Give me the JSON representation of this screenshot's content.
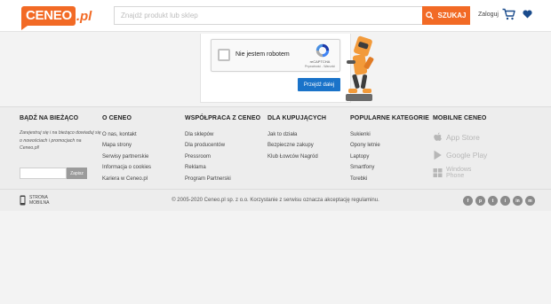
{
  "header": {
    "logo_text": "CENEO",
    "logo_suffix": ".pl",
    "search_placeholder": "Znajdź produkt lub sklep",
    "search_button": "SZUKAJ",
    "login": "Zaloguj",
    "brand_color": "#f26a25"
  },
  "captcha": {
    "label": "Nie jestem robotem",
    "brand": "reCAPTCHA",
    "links": "Prywatność - Warunki",
    "proceed_button": "Przejdź dalej"
  },
  "footer": {
    "newsletter": {
      "heading": "BĄDŹ NA BIEŻĄCO",
      "description": "Zarejestruj się i na bieżąco dowiaduj się o nowościach i promocjach na Ceneo.pl!",
      "button": "Zapisz"
    },
    "columns": [
      {
        "heading": "O CENEO",
        "links": [
          "O nas, kontakt",
          "Mapa strony",
          "Serwisy partnerskie",
          "Informacja o cookies",
          "Kariera w Ceneo.pl"
        ]
      },
      {
        "heading": "WSPÓŁPRACA Z CENEO",
        "links": [
          "Dla sklepów",
          "Dla producentów",
          "Pressroom",
          "Reklama",
          "Program Partnerski"
        ]
      },
      {
        "heading": "DLA KUPUJĄCYCH",
        "links": [
          "Jak to działa",
          "Bezpieczne zakupy",
          "Klub Łowców Nagród"
        ]
      },
      {
        "heading": "POPULARNE KATEGORIE",
        "links": [
          "Sukienki",
          "Opony letnie",
          "Laptopy",
          "Smartfony",
          "Torebki"
        ]
      }
    ],
    "mobile": {
      "heading": "MOBILNE CENEO",
      "stores": [
        "App Store",
        "Google Play",
        "Windows Phone"
      ]
    }
  },
  "bottom": {
    "mobile_site": "STRONA MOBILNA",
    "copyright": "© 2005-2020 Ceneo.pl sp. z o.o. Korzystanie z serwisu oznacza akceptację regulaminu.",
    "social": [
      "f",
      "p",
      "t",
      "i",
      "in",
      "m"
    ]
  }
}
